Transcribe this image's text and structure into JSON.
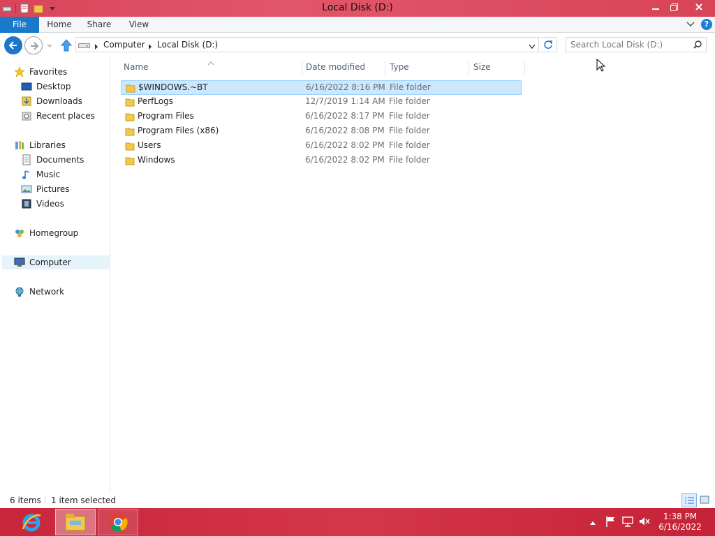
{
  "window": {
    "title": "Local Disk (D:)",
    "controls": [
      "minimize",
      "restore",
      "close"
    ]
  },
  "ribbon": {
    "tabs": [
      {
        "label": "File",
        "active": true
      },
      {
        "label": "Home"
      },
      {
        "label": "Share"
      },
      {
        "label": "View"
      }
    ]
  },
  "address": {
    "breadcrumbs": [
      "Computer",
      "Local Disk (D:)"
    ],
    "search_placeholder": "Search Local Disk (D:)"
  },
  "sidebar": {
    "favorites": {
      "label": "Favorites",
      "items": [
        {
          "label": "Desktop",
          "icon": "desktop-icon"
        },
        {
          "label": "Downloads",
          "icon": "downloads-icon"
        },
        {
          "label": "Recent places",
          "icon": "recent-places-icon"
        }
      ]
    },
    "libraries": {
      "label": "Libraries",
      "items": [
        {
          "label": "Documents",
          "icon": "documents-icon"
        },
        {
          "label": "Music",
          "icon": "music-icon"
        },
        {
          "label": "Pictures",
          "icon": "pictures-icon"
        },
        {
          "label": "Videos",
          "icon": "videos-icon"
        }
      ]
    },
    "homegroup": {
      "label": "Homegroup"
    },
    "computer": {
      "label": "Computer",
      "selected": true
    },
    "network": {
      "label": "Network"
    }
  },
  "files": {
    "columns": [
      "Name",
      "Date modified",
      "Type",
      "Size"
    ],
    "rows": [
      {
        "name": "$WINDOWS.~BT",
        "date": "6/16/2022 8:16 PM",
        "type": "File folder",
        "selected": true
      },
      {
        "name": "PerfLogs",
        "date": "12/7/2019 1:14 AM",
        "type": "File folder"
      },
      {
        "name": "Program Files",
        "date": "6/16/2022 8:17 PM",
        "type": "File folder"
      },
      {
        "name": "Program Files (x86)",
        "date": "6/16/2022 8:08 PM",
        "type": "File folder"
      },
      {
        "name": "Users",
        "date": "6/16/2022 8:02 PM",
        "type": "File folder"
      },
      {
        "name": "Windows",
        "date": "6/16/2022 8:02 PM",
        "type": "File folder"
      }
    ]
  },
  "status": {
    "item_count": "6 items",
    "selection": "1 item selected"
  },
  "taskbar": {
    "apps": [
      "internet-explorer-icon",
      "file-explorer-icon",
      "chrome-icon"
    ],
    "clock_time": "1:38 PM",
    "clock_date": "6/16/2022"
  },
  "colors": {
    "accent": "#1979ca",
    "titlebar": "#dd4b5f",
    "taskbar": "#cc2c40",
    "selection": "#cce8ff"
  }
}
